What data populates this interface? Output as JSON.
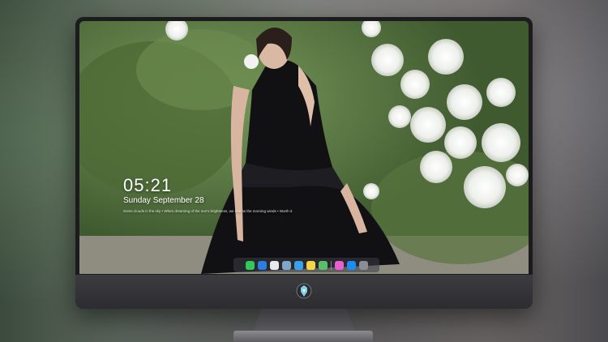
{
  "clock": {
    "time": "05:21",
    "date": "Sunday September 28",
    "quote": "Some clouds in the sky • When dreaming of the sun's brightness, we rise as the morning winds • Worth it"
  },
  "dock": {
    "icons": [
      {
        "name": "messages-icon",
        "color": "#34c759"
      },
      {
        "name": "finder-icon",
        "color": "#2a7de1"
      },
      {
        "name": "safari-icon",
        "color": "#e8e8ee"
      },
      {
        "name": "preview-icon",
        "color": "#7fa7c8"
      },
      {
        "name": "claquette-icon",
        "color": "#3aa0e8"
      },
      {
        "name": "notes-icon",
        "color": "#f5d547"
      },
      {
        "name": "photos-icon",
        "color": "#5bbf6a"
      },
      {
        "name": "itunes-icon",
        "color": "#e85fd0"
      },
      {
        "name": "app-store-icon",
        "color": "#1b8cf2"
      },
      {
        "name": "screenshot-icon",
        "color": "#8a8d96"
      }
    ]
  }
}
